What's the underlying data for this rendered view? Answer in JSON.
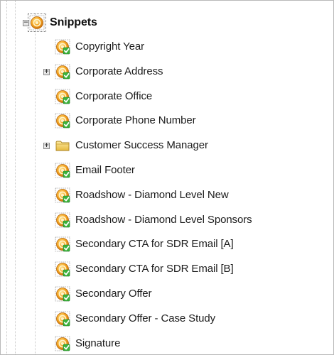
{
  "tree": {
    "root": {
      "label": "Snippets",
      "expander": "−",
      "icon": "snippet-folder-icon"
    },
    "items": [
      {
        "label": "Copyright Year",
        "icon": "snippet-approved-icon",
        "expander": ""
      },
      {
        "label": "Corporate Address",
        "icon": "snippet-approved-icon",
        "expander": "+"
      },
      {
        "label": "Corporate Office",
        "icon": "snippet-approved-icon",
        "expander": ""
      },
      {
        "label": "Corporate Phone Number",
        "icon": "snippet-approved-icon",
        "expander": ""
      },
      {
        "label": "Customer Success Manager",
        "icon": "folder-icon",
        "expander": "+"
      },
      {
        "label": "Email Footer",
        "icon": "snippet-approved-icon",
        "expander": ""
      },
      {
        "label": "Roadshow - Diamond Level New",
        "icon": "snippet-approved-icon",
        "expander": ""
      },
      {
        "label": "Roadshow - Diamond Level Sponsors",
        "icon": "snippet-approved-icon",
        "expander": ""
      },
      {
        "label": "Secondary CTA for SDR Email [A]",
        "icon": "snippet-approved-icon",
        "expander": ""
      },
      {
        "label": "Secondary CTA for SDR Email [B]",
        "icon": "snippet-approved-icon",
        "expander": ""
      },
      {
        "label": "Secondary Offer",
        "icon": "snippet-approved-icon",
        "expander": ""
      },
      {
        "label": "Secondary Offer - Case Study",
        "icon": "snippet-approved-icon",
        "expander": ""
      },
      {
        "label": "Signature",
        "icon": "snippet-approved-icon",
        "expander": ""
      }
    ]
  },
  "colors": {
    "text": "#1c1c1c",
    "icon_orange": "#f0a020",
    "icon_check": "#2fa12f",
    "folder_yellow": "#f3d36b"
  }
}
